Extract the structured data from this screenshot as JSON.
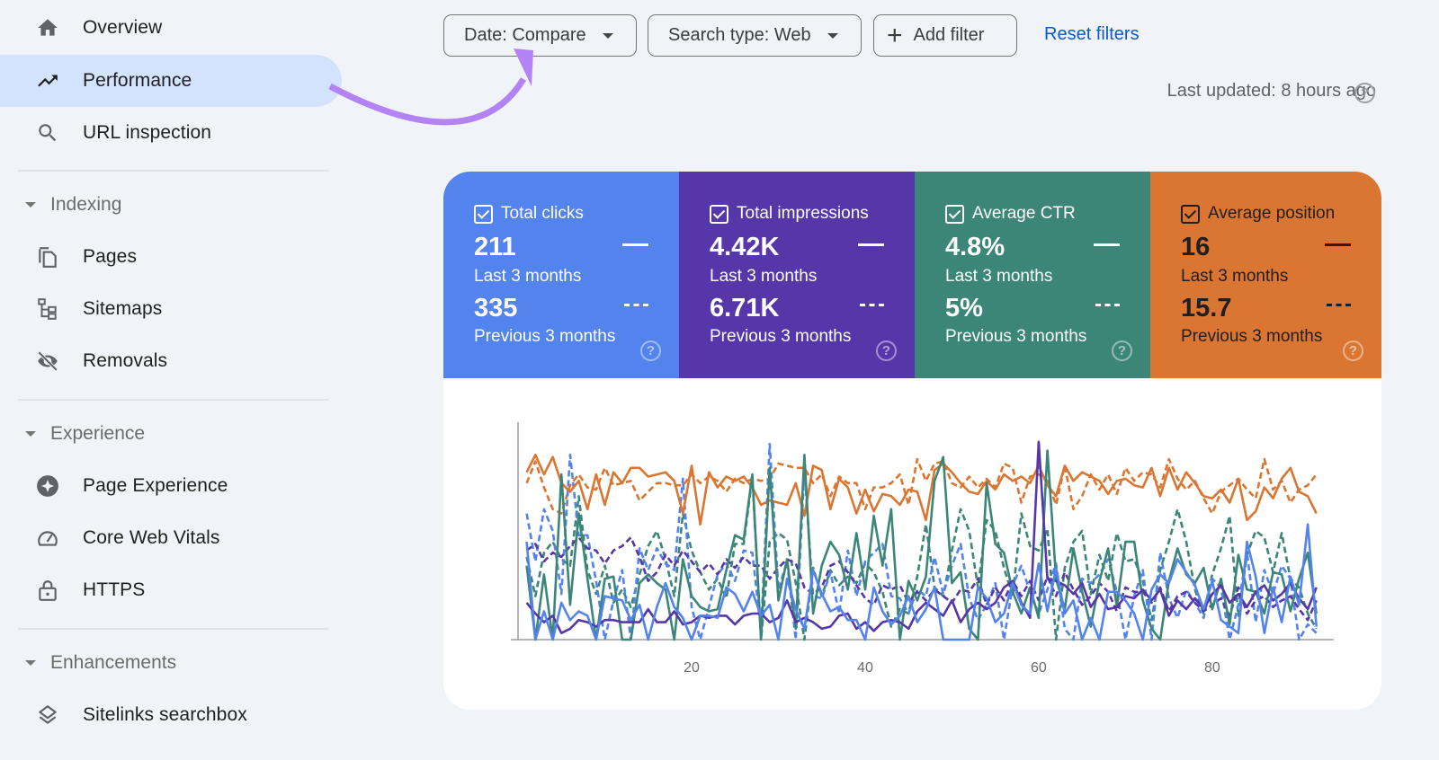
{
  "sidebar": {
    "items": [
      {
        "label": "Overview",
        "icon": "home-icon",
        "active": false
      },
      {
        "label": "Performance",
        "icon": "trending-up-icon",
        "active": true
      },
      {
        "label": "URL inspection",
        "icon": "search-icon",
        "active": false
      }
    ],
    "sections": [
      {
        "title": "Indexing",
        "items": [
          {
            "label": "Pages",
            "icon": "pages-icon"
          },
          {
            "label": "Sitemaps",
            "icon": "sitemap-icon"
          },
          {
            "label": "Removals",
            "icon": "eye-off-icon"
          }
        ]
      },
      {
        "title": "Experience",
        "items": [
          {
            "label": "Page Experience",
            "icon": "page-experience-icon"
          },
          {
            "label": "Core Web Vitals",
            "icon": "speedometer-icon"
          },
          {
            "label": "HTTPS",
            "icon": "lock-icon"
          }
        ]
      },
      {
        "title": "Enhancements",
        "items": [
          {
            "label": "Sitelinks searchbox",
            "icon": "layers-icon"
          }
        ]
      }
    ]
  },
  "filters": {
    "date_label": "Date: Compare",
    "search_type_label": "Search type: Web",
    "add_filter_label": "Add filter",
    "reset_label": "Reset filters",
    "last_updated": "Last updated: 8 hours ago",
    "help_symbol": "?"
  },
  "metrics": [
    {
      "title": "Total clicks",
      "current": "211",
      "current_label": "Last 3 months",
      "previous": "335",
      "previous_label": "Previous 3 months",
      "color": "#5383ec",
      "text_color": "#ffffff",
      "checked": true
    },
    {
      "title": "Total impressions",
      "current": "4.42K",
      "current_label": "Last 3 months",
      "previous": "6.71K",
      "previous_label": "Previous 3 months",
      "color": "#5637a9",
      "text_color": "#ffffff",
      "checked": true
    },
    {
      "title": "Average CTR",
      "current": "4.8%",
      "current_label": "Last 3 months",
      "previous": "5%",
      "previous_label": "Previous 3 months",
      "color": "#3b8677",
      "text_color": "#ffffff",
      "checked": true
    },
    {
      "title": "Average position",
      "current": "16",
      "current_label": "Last 3 months",
      "previous": "15.7",
      "previous_label": "Previous 3 months",
      "color": "#da7631",
      "text_color": "#1f1f1f",
      "checked": true
    }
  ],
  "annotation": {
    "color": "#b383f5"
  },
  "chart_data": {
    "type": "line",
    "title": "",
    "xlabel": "",
    "ylabel": "",
    "x_range": [
      1,
      92
    ],
    "xlim": [
      0,
      94
    ],
    "ylim": [
      0,
      100
    ],
    "x_ticks": [
      20,
      40,
      60,
      80
    ],
    "y_ticks": [],
    "grid": false,
    "legend": "none (metric cards act as legend)",
    "series": [
      {
        "name": "Average position (Last 3 months)",
        "color": "#da7631",
        "style": "solid",
        "values": [
          77,
          85,
          76,
          84,
          72,
          68,
          73,
          60,
          76,
          62,
          77,
          72,
          79,
          79,
          75,
          76,
          77,
          73,
          58,
          80,
          53,
          77,
          70,
          75,
          73,
          75,
          70,
          62,
          64,
          63,
          62,
          72,
          57,
          80,
          78,
          60,
          74,
          70,
          58,
          69,
          59,
          67,
          66,
          62,
          69,
          68,
          55,
          78,
          81,
          77,
          72,
          68,
          67,
          73,
          69,
          76,
          73,
          75,
          72,
          80,
          71,
          66,
          80,
          73,
          77,
          75,
          73,
          67,
          73,
          74,
          71,
          70,
          79,
          66,
          79,
          69,
          77,
          72,
          66,
          65,
          69,
          63,
          74,
          55,
          59,
          70,
          65,
          74,
          79,
          68,
          66,
          58
        ]
      },
      {
        "name": "Average position (Previous 3 months)",
        "color": "#da7631",
        "style": "dashed",
        "values": [
          72,
          82,
          70,
          60,
          58,
          71,
          76,
          70,
          69,
          79,
          71,
          72,
          73,
          64,
          68,
          72,
          72,
          71,
          71,
          76,
          72,
          75,
          73,
          68,
          74,
          72,
          74,
          73,
          74,
          81,
          80,
          79,
          79,
          72,
          76,
          66,
          75,
          72,
          72,
          60,
          70,
          70,
          72,
          76,
          62,
          83,
          73,
          81,
          82,
          72,
          70,
          75,
          70,
          74,
          70,
          81,
          79,
          63,
          75,
          76,
          73,
          62,
          80,
          60,
          66,
          76,
          69,
          76,
          67,
          79,
          73,
          77,
          76,
          70,
          83,
          74,
          69,
          73,
          65,
          58,
          68,
          71,
          74,
          69,
          65,
          83,
          69,
          73,
          63,
          69,
          71,
          76
        ]
      },
      {
        "name": "Average CTR (Last 3 months)",
        "color": "#3b8677",
        "style": "solid",
        "values": [
          34,
          0,
          30,
          0,
          76,
          16,
          58,
          28,
          0,
          28,
          29,
          0,
          0,
          26,
          30,
          26,
          23,
          0,
          37,
          20,
          15,
          13,
          14,
          32,
          48,
          46,
          76,
          0,
          79,
          18,
          37,
          5,
          85,
          12,
          34,
          45,
          39,
          23,
          49,
          23,
          57,
          34,
          60,
          0,
          27,
          18,
          29,
          73,
          84,
          26,
          31,
          5,
          0,
          72,
          44,
          40,
          22,
          12,
          24,
          10,
          87,
          28,
          14,
          42,
          22,
          6,
          27,
          42,
          15,
          45,
          45,
          18,
          5,
          0,
          27,
          42,
          30,
          26,
          33,
          14,
          28,
          7,
          39,
          23,
          22,
          12,
          31,
          30,
          13,
          28,
          40,
          12
        ]
      },
      {
        "name": "Average CTR (Previous 3 months)",
        "color": "#3b8677",
        "style": "dashed",
        "values": [
          38,
          20,
          40,
          45,
          37,
          34,
          66,
          32,
          21,
          34,
          17,
          23,
          15,
          30,
          43,
          50,
          37,
          20,
          58,
          41,
          31,
          23,
          28,
          19,
          44,
          44,
          75,
          0,
          45,
          49,
          46,
          26,
          0,
          33,
          20,
          32,
          25,
          29,
          26,
          35,
          31,
          22,
          6,
          14,
          12,
          29,
          53,
          24,
          20,
          41,
          60,
          50,
          24,
          55,
          50,
          33,
          20,
          58,
          43,
          41,
          51,
          0,
          33,
          45,
          50,
          21,
          39,
          27,
          49,
          36,
          37,
          27,
          9,
          32,
          45,
          60,
          45,
          23,
          12,
          30,
          42,
          57,
          11,
          39,
          50,
          47,
          31,
          49,
          28,
          24,
          12,
          5
        ]
      },
      {
        "name": "Total clicks (Last 3 months)",
        "color": "#5383ec",
        "style": "solid",
        "values": [
          45,
          0,
          13,
          0,
          17,
          9,
          13,
          11,
          0,
          20,
          19,
          18,
          9,
          16,
          0,
          15,
          26,
          15,
          10,
          0,
          11,
          11,
          10,
          24,
          21,
          13,
          22,
          11,
          16,
          0,
          28,
          14,
          5,
          32,
          21,
          13,
          15,
          9,
          9,
          0,
          24,
          13,
          7,
          11,
          20,
          8,
          14,
          24,
          0,
          0,
          0,
          0,
          24,
          19,
          8,
          12,
          26,
          16,
          12,
          35,
          13,
          33,
          12,
          18,
          0,
          10,
          0,
          22,
          22,
          18,
          12,
          0,
          23,
          30,
          26,
          37,
          31,
          25,
          14,
          27,
          9,
          6,
          3,
          45,
          29,
          3,
          24,
          8,
          29,
          16,
          53,
          6
        ]
      },
      {
        "name": "Total clicks (Previous 3 months)",
        "color": "#5383ec",
        "style": "dashed",
        "values": [
          58,
          36,
          60,
          50,
          21,
          85,
          48,
          48,
          27,
          0,
          18,
          32,
          0,
          42,
          32,
          42,
          35,
          32,
          74,
          15,
          0,
          15,
          30,
          35,
          27,
          41,
          40,
          4,
          90,
          23,
          36,
          0,
          78,
          20,
          19,
          31,
          12,
          41,
          20,
          36,
          40,
          44,
          20,
          19,
          12,
          23,
          20,
          38,
          21,
          34,
          44,
          19,
          9,
          16,
          26,
          0,
          25,
          34,
          22,
          12,
          23,
          35,
          5,
          0,
          28,
          26,
          30,
          37,
          22,
          0,
          20,
          32,
          0,
          40,
          19,
          10,
          23,
          17,
          10,
          28,
          24,
          0,
          16,
          40,
          8,
          32,
          21,
          34,
          28,
          0,
          7,
          3
        ]
      },
      {
        "name": "Total impressions (Last 3 months)",
        "color": "#5637a9",
        "style": "solid",
        "values": [
          17,
          12,
          8,
          11,
          3,
          5,
          9,
          8,
          6,
          9,
          9,
          8,
          8,
          8,
          14,
          8,
          8,
          13,
          7,
          8,
          11,
          10,
          11,
          11,
          7,
          11,
          12,
          12,
          8,
          10,
          18,
          8,
          10,
          8,
          5,
          6,
          11,
          12,
          5,
          8,
          4,
          8,
          9,
          8,
          5,
          13,
          17,
          14,
          11,
          18,
          8,
          14,
          17,
          14,
          17,
          24,
          27,
          17,
          10,
          91,
          28,
          27,
          25,
          21,
          26,
          15,
          21,
          14,
          15,
          20,
          19,
          23,
          18,
          23,
          11,
          18,
          14,
          19,
          14,
          21,
          25,
          17,
          21,
          15,
          22,
          25,
          18,
          21,
          26,
          19,
          14,
          24
        ]
      },
      {
        "name": "Total impressions (Previous 3 months)",
        "color": "#5637a9",
        "style": "dashed",
        "values": [
          41,
          44,
          36,
          40,
          38,
          43,
          47,
          42,
          41,
          35,
          41,
          43,
          47,
          38,
          27,
          31,
          39,
          34,
          41,
          36,
          31,
          35,
          30,
          37,
          33,
          38,
          34,
          34,
          28,
          33,
          37,
          35,
          24,
          21,
          24,
          34,
          36,
          31,
          25,
          19,
          16,
          25,
          23,
          25,
          17,
          22,
          18,
          23,
          20,
          17,
          23,
          22,
          28,
          16,
          24,
          18,
          27,
          20,
          27,
          18,
          29,
          20,
          31,
          23,
          16,
          20,
          26,
          22,
          13,
          24,
          22,
          22,
          17,
          24,
          13,
          20,
          22,
          17,
          13,
          16,
          19,
          11,
          24,
          12,
          18,
          20,
          15,
          18,
          20,
          14,
          9,
          18
        ]
      }
    ]
  }
}
